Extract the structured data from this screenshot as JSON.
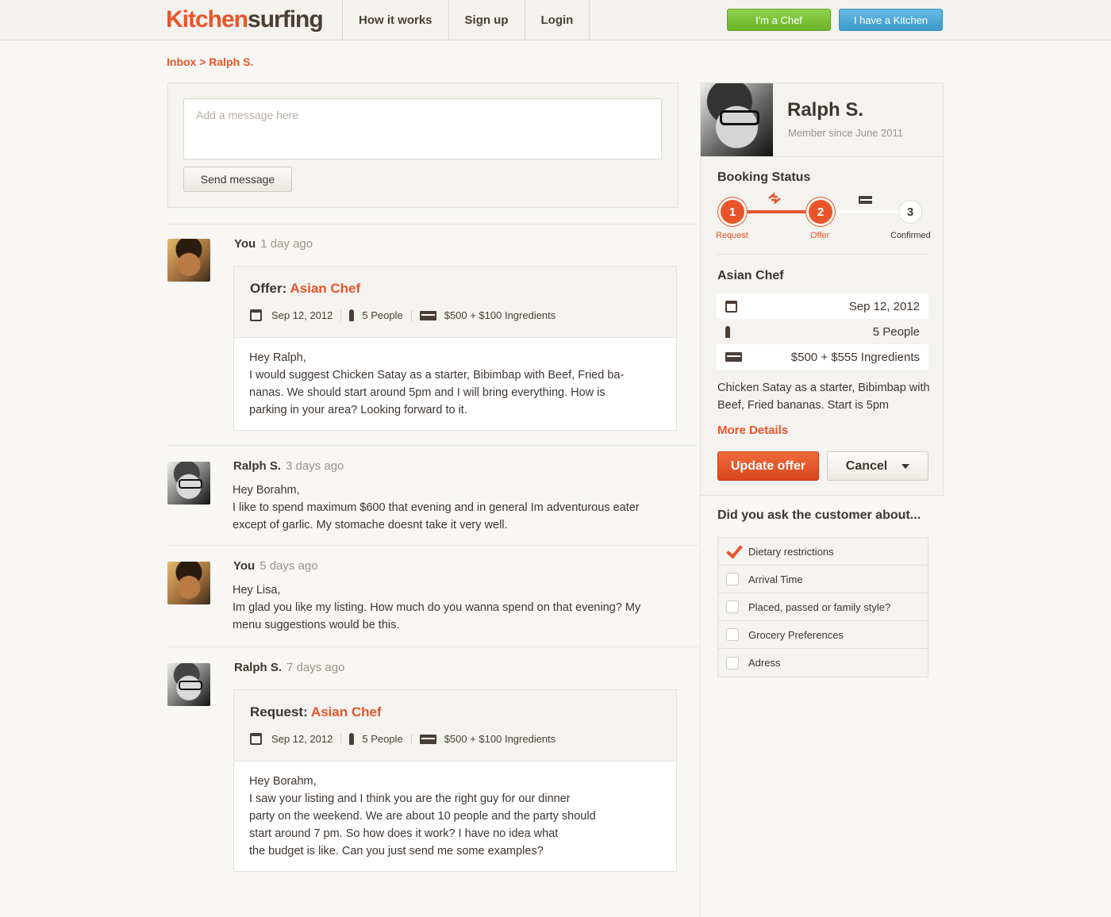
{
  "brand": {
    "logo_part1": "Kitchen",
    "logo_part2": "surfing"
  },
  "nav": [
    {
      "label": "How it works"
    },
    {
      "label": "Sign up"
    },
    {
      "label": "Login"
    }
  ],
  "top_buttons": {
    "chef": "I'm a Chef",
    "kitchen": "I have a Kitchen"
  },
  "breadcrumb": "Inbox > Ralph S.",
  "compose": {
    "placeholder": "Add a message here",
    "send_label": "Send message"
  },
  "messages": [
    {
      "who": "You",
      "when": "1 day ago",
      "card": {
        "title_prefix": "Offer:",
        "title_value": "Asian Chef",
        "date": "Sep 12, 2012",
        "people": "5 People",
        "price": "$500 + $100 Ingredients",
        "body": [
          "Hey Ralph,",
          "I would suggest Chicken Satay as a starter, Bibimbap with Beef, Fried ba-",
          "nanas. We should start around 5pm and I will bring everything. How is",
          "parking in your area? Looking forward to it."
        ]
      }
    },
    {
      "who": "Ralph S.",
      "when": "3 days ago",
      "text": [
        "Hey Borahm,",
        "I like to spend maximum $600 that evening and in general Im adventurous  eater",
        "except of garlic. My stomache doesnt take it very well."
      ]
    },
    {
      "who": "You",
      "when": "5 days ago",
      "text": [
        "Hey Lisa,",
        "Im glad you like my listing. How much do you wanna spend on that evening? My",
        "menu suggestions would be this."
      ]
    },
    {
      "who": "Ralph S.",
      "when": "7 days ago",
      "card": {
        "title_prefix": "Request:",
        "title_value": "Asian Chef",
        "date": "Sep 12, 2012",
        "people": "5 People",
        "price": "$500 + $100 Ingredients",
        "body": [
          "Hey Borahm,",
          "I saw your listing and I think you are the right guy for our dinner",
          "party on the weekend. We are about 10 people and the party should",
          "start around 7 pm.  So how does it work? I have no idea what",
          "the budget is like. Can you just send me some examples?"
        ]
      }
    }
  ],
  "profile": {
    "name": "Ralph S.",
    "since": "Member since June 2011"
  },
  "booking": {
    "title": "Booking Status",
    "steps": [
      {
        "num": "1",
        "label": "Request"
      },
      {
        "num": "2",
        "label": "Offer"
      },
      {
        "num": "3",
        "label": "Confirmed"
      }
    ],
    "service": "Asian Chef",
    "date": "Sep 12, 2012",
    "people": "5 People",
    "price": "$500 + $555 Ingredients",
    "description": "Chicken Satay as a starter, Bibimbap with Beef, Fried bananas. Start is 5pm",
    "more": "More Details",
    "update_label": "Update offer",
    "cancel_label": "Cancel"
  },
  "checklist": {
    "title": "Did you ask the customer about...",
    "items": [
      {
        "label": "Dietary restrictions",
        "checked": true
      },
      {
        "label": "Arrival Time",
        "checked": false
      },
      {
        "label": "Placed, passed or family style?",
        "checked": false
      },
      {
        "label": "Grocery Preferences",
        "checked": false
      },
      {
        "label": "Adress",
        "checked": false
      }
    ]
  },
  "colors": {
    "accent": "#e8552a",
    "chef_green": "#7cc23a",
    "kitchen_blue": "#4aa8d6"
  }
}
